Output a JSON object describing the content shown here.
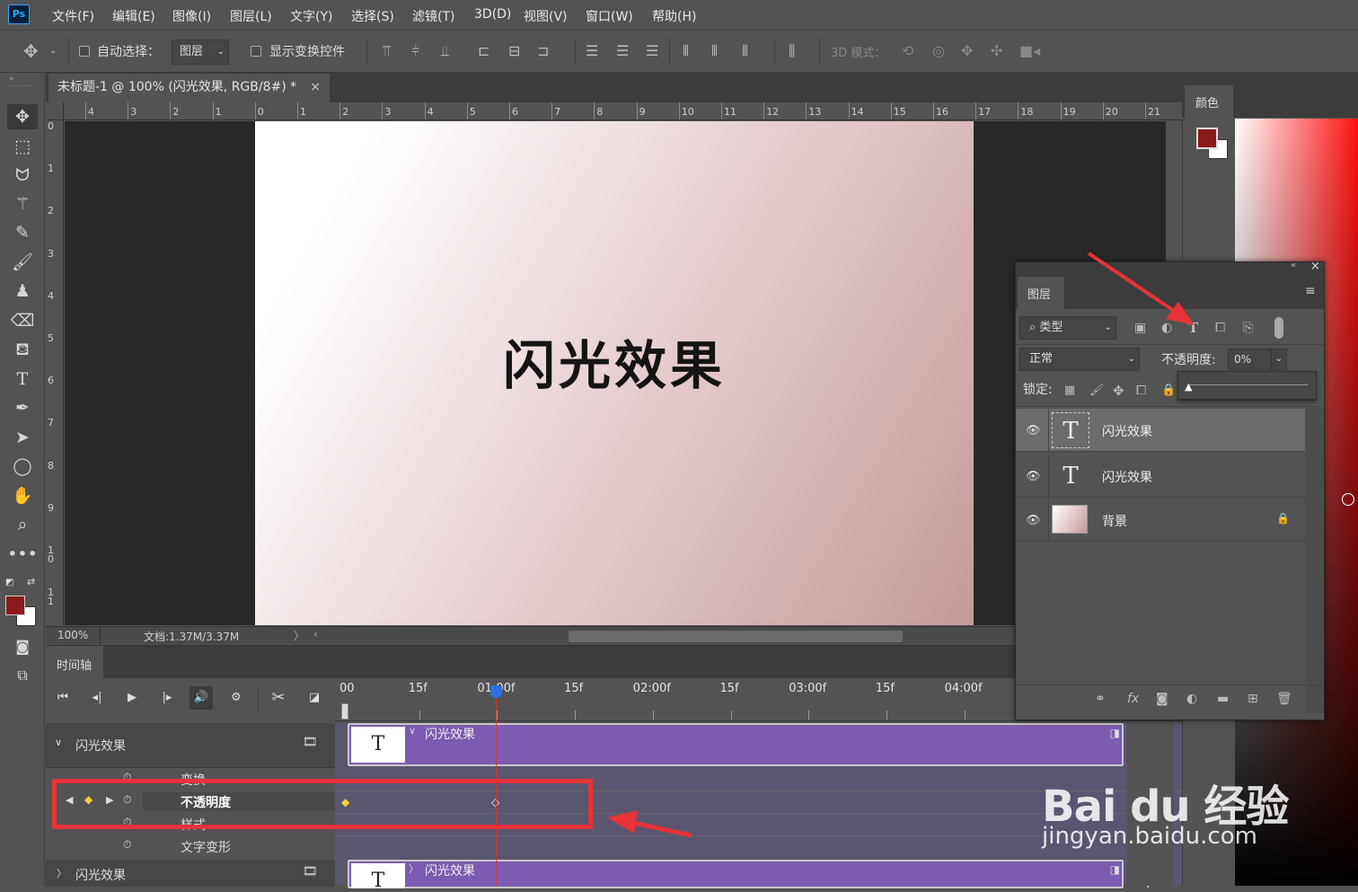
{
  "app": {
    "logo": "Ps"
  },
  "menu": [
    "文件(F)",
    "编辑(E)",
    "图像(I)",
    "图层(L)",
    "文字(Y)",
    "选择(S)",
    "滤镜(T)",
    "3D(D)",
    "视图(V)",
    "窗口(W)",
    "帮助(H)"
  ],
  "options": {
    "auto_select": "自动选择：",
    "auto_select_target": "图层",
    "show_transform": "显示变换控件",
    "mode_3d": "3D 模式："
  },
  "document": {
    "tab_title": "未标题-1 @ 100% (闪光效果, RGB/8#) *",
    "canvas_text": "闪光效果",
    "zoom": "100%",
    "doc_info": "文档:1.37M/3.37M"
  },
  "ruler": {
    "h": [
      "4",
      "3",
      "2",
      "1",
      "0",
      "1",
      "2",
      "3",
      "4",
      "5",
      "6",
      "7",
      "8",
      "9",
      "10",
      "11",
      "12",
      "13",
      "14",
      "15",
      "16",
      "17",
      "18",
      "19",
      "20",
      "21"
    ],
    "v": [
      "0",
      "1",
      "2",
      "3",
      "4",
      "5",
      "6",
      "7",
      "8",
      "9",
      "1\n0",
      "1\n1"
    ]
  },
  "timeline": {
    "title": "时间轴",
    "timecodes": [
      "00",
      "15f",
      "01:00f",
      "15f",
      "02:00f",
      "15f",
      "03:00f",
      "15f",
      "04:00f"
    ],
    "layer1": "闪光效果",
    "props": [
      "变换",
      "不透明度",
      "样式",
      "文字变形"
    ],
    "layer2": "闪光效果",
    "clip1": "闪光效果",
    "clip2": "闪光效果"
  },
  "color_panel": {
    "title": "颜色",
    "fg": "#8b1a1a",
    "bg": "#ffffff"
  },
  "layers_panel": {
    "title": "图层",
    "filter": "类型",
    "blend": "正常",
    "opacity_label": "不透明度:",
    "opacity_value": "0%",
    "lock_label": "锁定:",
    "opacity_slider": 0,
    "layers": [
      {
        "name": "闪光效果",
        "type": "text",
        "selected": true
      },
      {
        "name": "闪光效果",
        "type": "text",
        "selected": false
      },
      {
        "name": "背景",
        "type": "image",
        "locked": true
      }
    ]
  },
  "watermark": {
    "brand": "Bai du 经验",
    "url": "jingyan.baidu.com"
  },
  "colors": {
    "accent_red": "#e8333a",
    "clip_purple": "#7b5cb0",
    "playhead": "#d93434",
    "timeline_blue": "#2d6ee0"
  }
}
